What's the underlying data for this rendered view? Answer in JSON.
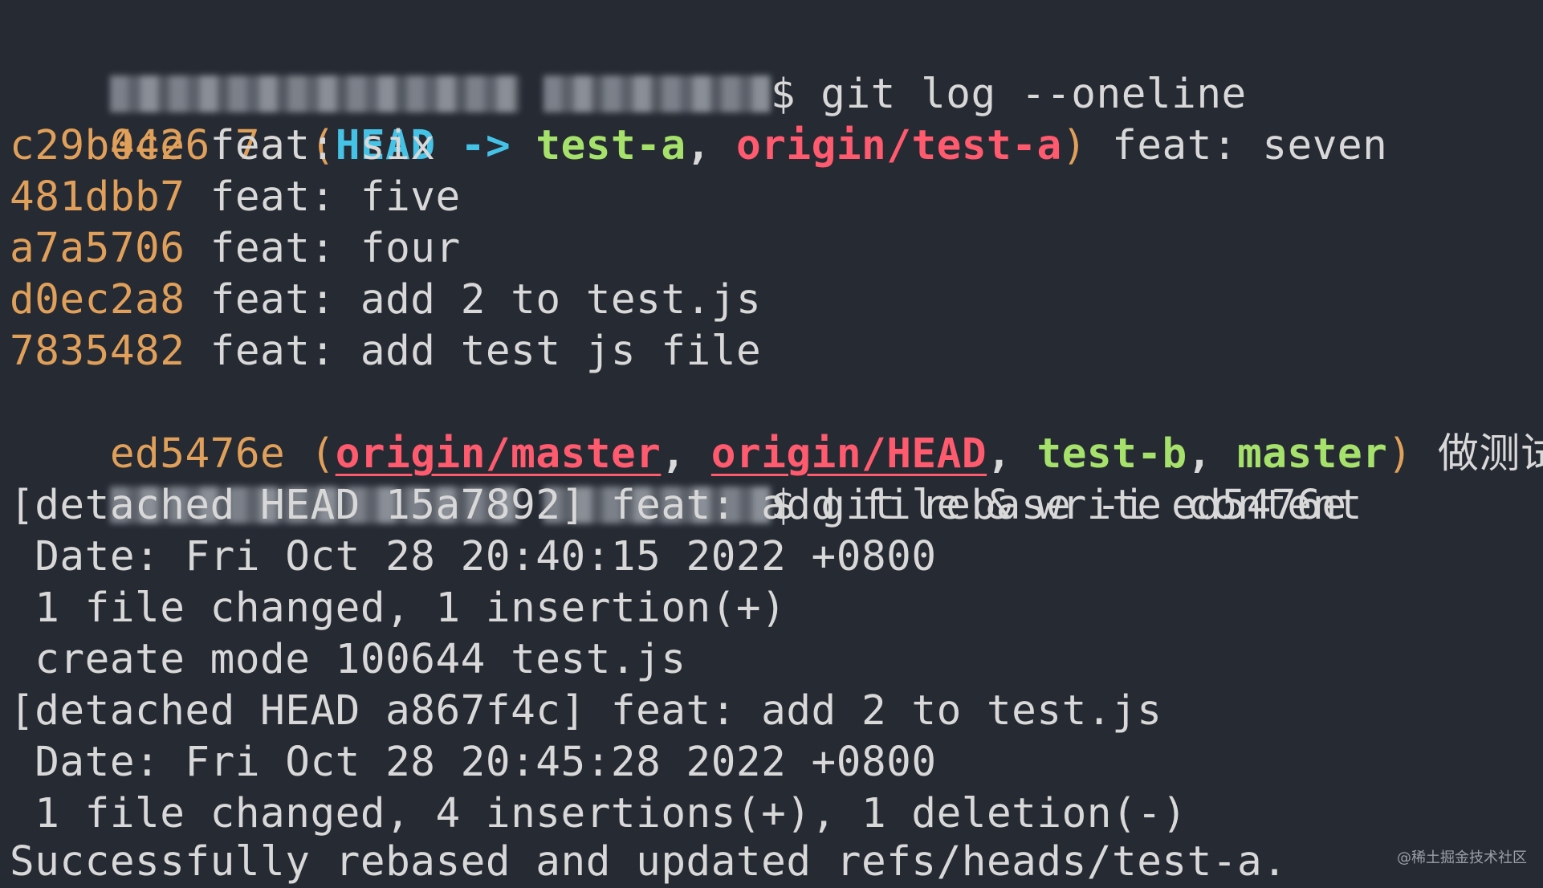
{
  "terminal": {
    "prompt_suffix": "$ ",
    "command1": "git log --oneline",
    "log": [
      {
        "hash": "0ce6f7a",
        "message": "feat: seven"
      },
      {
        "hash": "c29b442",
        "message": "feat: six"
      },
      {
        "hash": "481dbb7",
        "message": "feat: five"
      },
      {
        "hash": "a7a5706",
        "message": "feat: four"
      },
      {
        "hash": "d0ec2a8",
        "message": "feat: add 2 to test.js"
      },
      {
        "hash": "7835482",
        "message": "feat: add test js file"
      },
      {
        "hash": "ed5476e",
        "message": "做测试"
      }
    ],
    "refs": {
      "open_paren": "(",
      "close_paren": ")",
      "comma": ", ",
      "head": "HEAD",
      "arrow": " -> ",
      "test_a": "test-a",
      "origin_test_a": "origin/test-a",
      "origin_master": "origin/master",
      "origin_head": "origin/HEAD",
      "test_b": "test-b",
      "master": "master"
    },
    "command2": "git rebase -i ed5476e",
    "output": [
      "[detached HEAD 15a7892] feat: add file & write content",
      " Date: Fri Oct 28 20:40:15 2022 +0800",
      " 1 file changed, 1 insertion(+)",
      " create mode 100644 test.js",
      "[detached HEAD a867f4c] feat: add 2 to test.js",
      " Date: Fri Oct 28 20:45:28 2022 +0800",
      " 1 file changed, 4 insertions(+), 1 deletion(-)",
      "Successfully rebased and updated refs/heads/test-a."
    ],
    "colors": {
      "background": "#262a33",
      "text": "#d8d8d8",
      "hash": "#e0a05a",
      "head": "#45c3e6",
      "local_branch": "#a6e26b",
      "remote_branch": "#ff5a6e"
    }
  },
  "watermark": "@稀土掘金技术社区"
}
